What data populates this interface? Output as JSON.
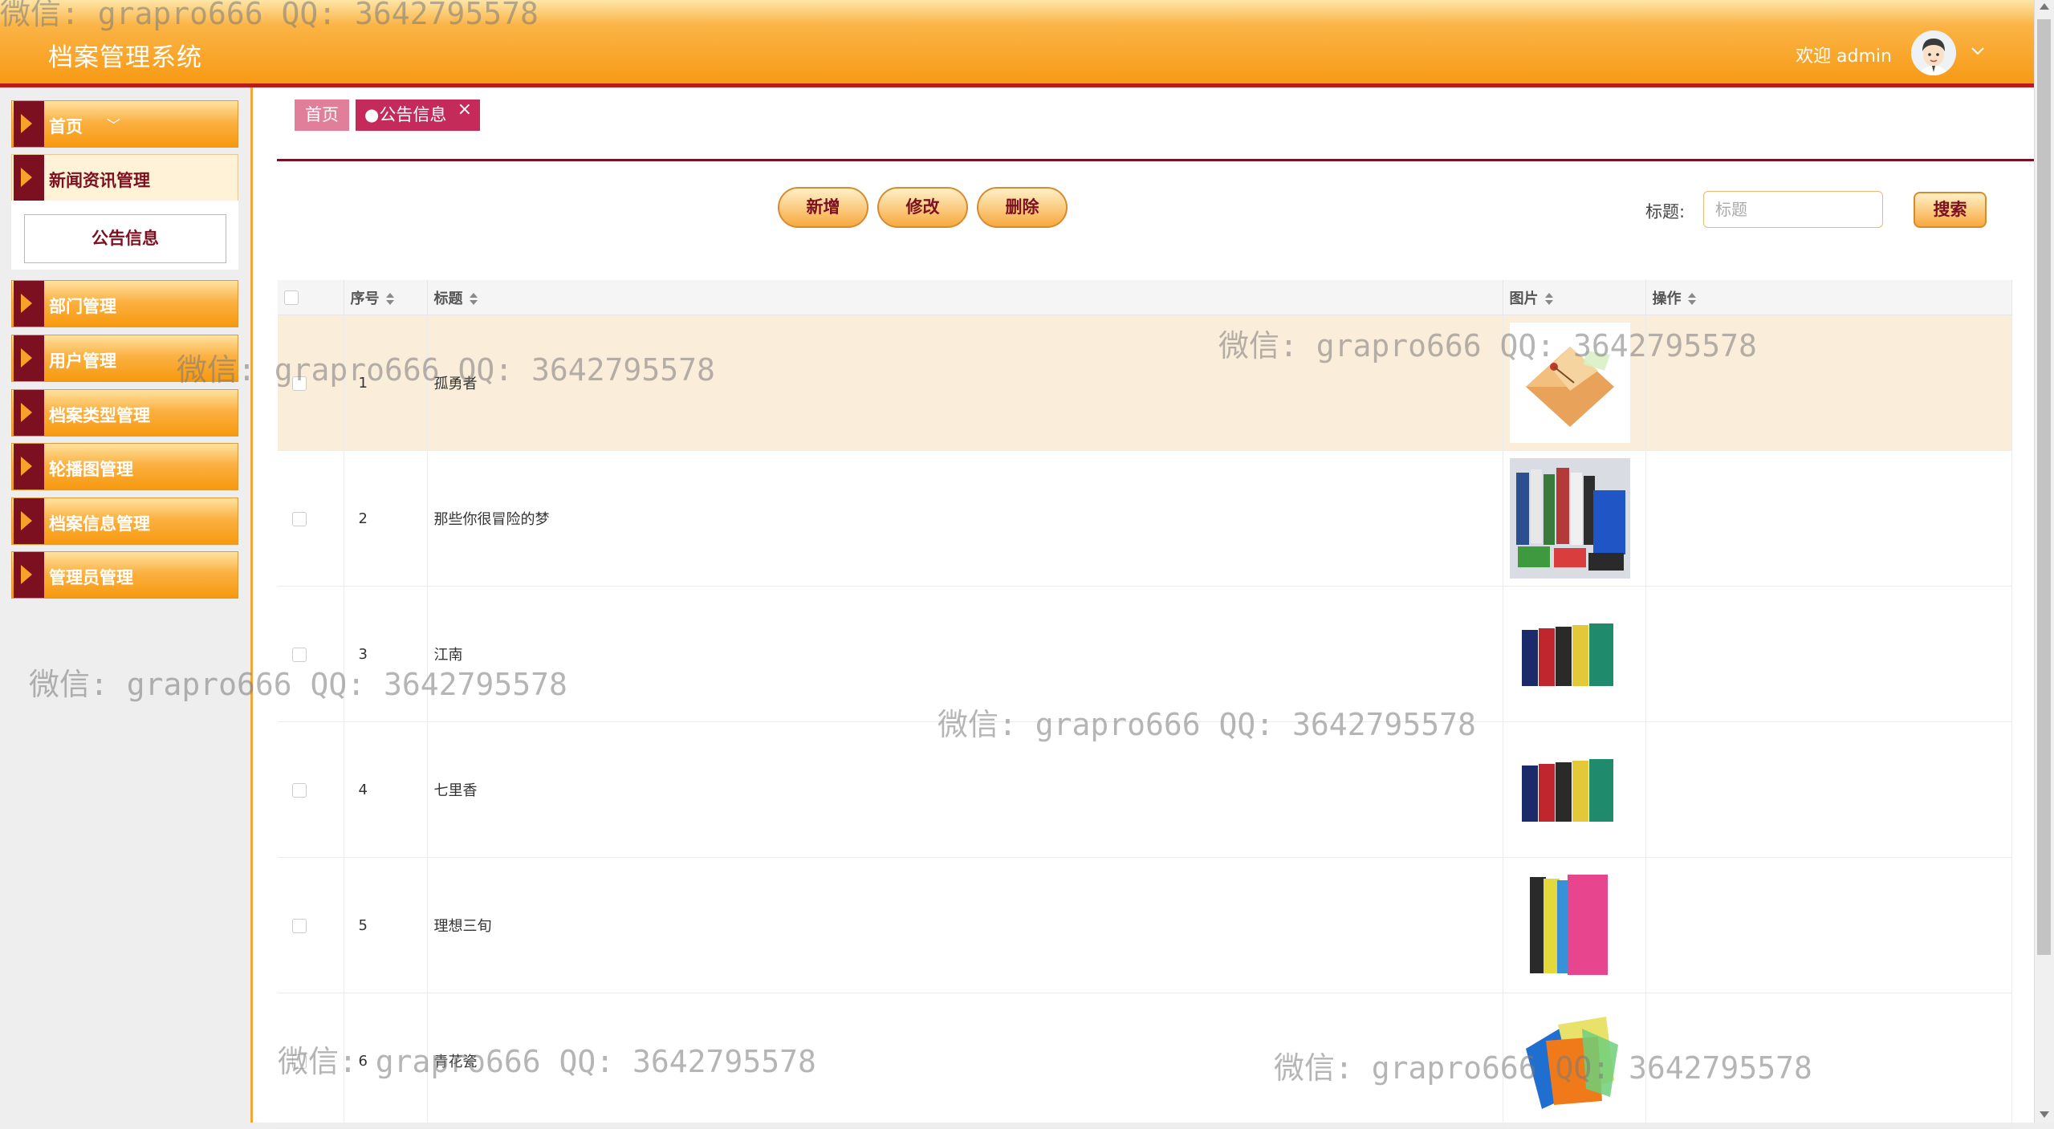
{
  "app": {
    "title": "档案管理系统",
    "welcome": "欢迎 admin"
  },
  "sidebar": {
    "items": [
      {
        "label": "首页",
        "chevron": "﹀"
      },
      {
        "label": "新闻资讯管理"
      },
      {
        "label": "部门管理"
      },
      {
        "label": "用户管理"
      },
      {
        "label": "档案类型管理"
      },
      {
        "label": "轮播图管理"
      },
      {
        "label": "档案信息管理"
      },
      {
        "label": "管理员管理"
      }
    ],
    "sub_item": "公告信息"
  },
  "tabs": {
    "home": "首页",
    "active": "●公告信息",
    "close": "×"
  },
  "toolbar": {
    "add": "新增",
    "edit": "修改",
    "delete": "删除"
  },
  "search": {
    "label": "标题:",
    "placeholder": "标题",
    "button": "搜索"
  },
  "table": {
    "headers": {
      "index": "序号",
      "title": "标题",
      "image": "图片",
      "action": "操作"
    },
    "rows": [
      {
        "index": "1",
        "title": "孤勇者"
      },
      {
        "index": "2",
        "title": "那些你很冒险的梦"
      },
      {
        "index": "3",
        "title": "江南"
      },
      {
        "index": "4",
        "title": "七里香"
      },
      {
        "index": "5",
        "title": "理想三旬"
      },
      {
        "index": "6",
        "title": "青花瓷"
      }
    ]
  },
  "watermark": "微信: grapro666 QQ: 3642795578",
  "colors": {
    "topbar": "#f79a15",
    "accent": "#7d1020",
    "tab_active": "#c42b5b",
    "row_highlight": "#faeedb"
  }
}
